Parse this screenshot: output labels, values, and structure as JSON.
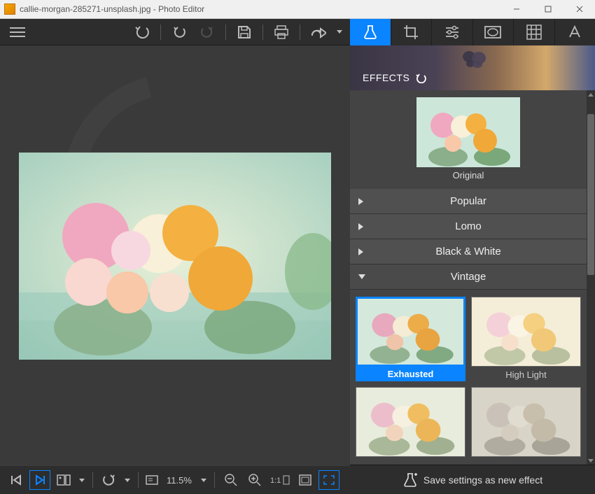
{
  "window": {
    "title": "callie-morgan-285271-unsplash.jpg - Photo Editor"
  },
  "effects": {
    "header_label": "EFFECTS",
    "original_label": "Original",
    "categories": [
      {
        "name": "Popular",
        "expanded": false
      },
      {
        "name": "Lomo",
        "expanded": false
      },
      {
        "name": "Black & White",
        "expanded": false
      },
      {
        "name": "Vintage",
        "expanded": true
      }
    ],
    "vintage_items": [
      {
        "name": "Exhausted",
        "selected": true
      },
      {
        "name": "High Light",
        "selected": false
      }
    ]
  },
  "zoom": {
    "value": "11.5%"
  },
  "save_button_label": "Save settings as new effect",
  "colors": {
    "accent": "#0a84ff"
  }
}
